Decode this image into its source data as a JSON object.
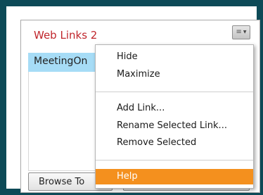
{
  "pod": {
    "title": "Web Links 2",
    "menu_button_icon": "menu-lines-icon",
    "links": [
      "MeetingOn"
    ],
    "browse_button_label": "Browse To"
  },
  "menu": {
    "items": [
      {
        "label": "Hide"
      },
      {
        "label": "Maximize"
      },
      {
        "label": "Add Link..."
      },
      {
        "label": "Rename Selected Link..."
      },
      {
        "label": "Remove Selected"
      },
      {
        "label": "Help",
        "highlighted": true
      }
    ]
  },
  "colors": {
    "frame_border": "#0d4a57",
    "title": "#c0262c",
    "selection": "#a6dcf6",
    "menu_highlight": "#f4901e"
  }
}
